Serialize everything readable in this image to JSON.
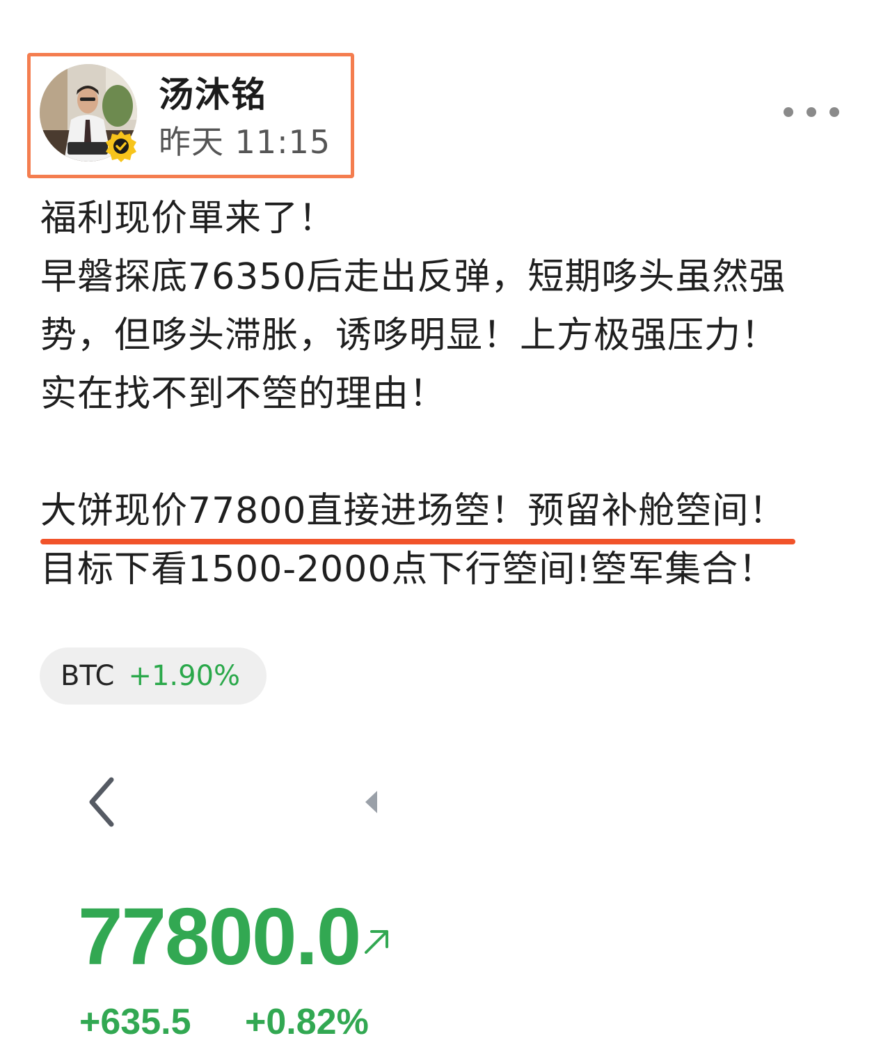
{
  "colors": {
    "highlight_border": "#f47d4f",
    "underline": "#f1532a",
    "positive": "#32a852",
    "chip_bg": "#efefef"
  },
  "author": {
    "name": "汤沐铭",
    "time": "昨天 11:15",
    "avatar_icon": "avatar-photo",
    "verified_icon": "verified-badge-icon"
  },
  "header": {
    "more_icon": "more-dots-icon"
  },
  "post": {
    "lines": [
      "福利现价單来了！",
      "早磐探底76350后走出反弹，短期哆头虽然强",
      "势，但哆头滞胀，诱哆明显！上方极强压力！",
      "实在找不到不箜的理由！",
      "大饼现价77800直接进场箜！预留补舱箜间！",
      "目标下看1500-2000点下行箜间!箜军集合！"
    ]
  },
  "ticker": {
    "symbol": "BTC",
    "change": "+1.90%"
  },
  "quote": {
    "back_icon": "chevron-left-icon",
    "arrow_icon": "triangle-left-icon",
    "price": "77800.0",
    "trend_icon": "arrow-up-right-icon",
    "change_abs": "+635.5",
    "change_pct": "+0.82%"
  }
}
